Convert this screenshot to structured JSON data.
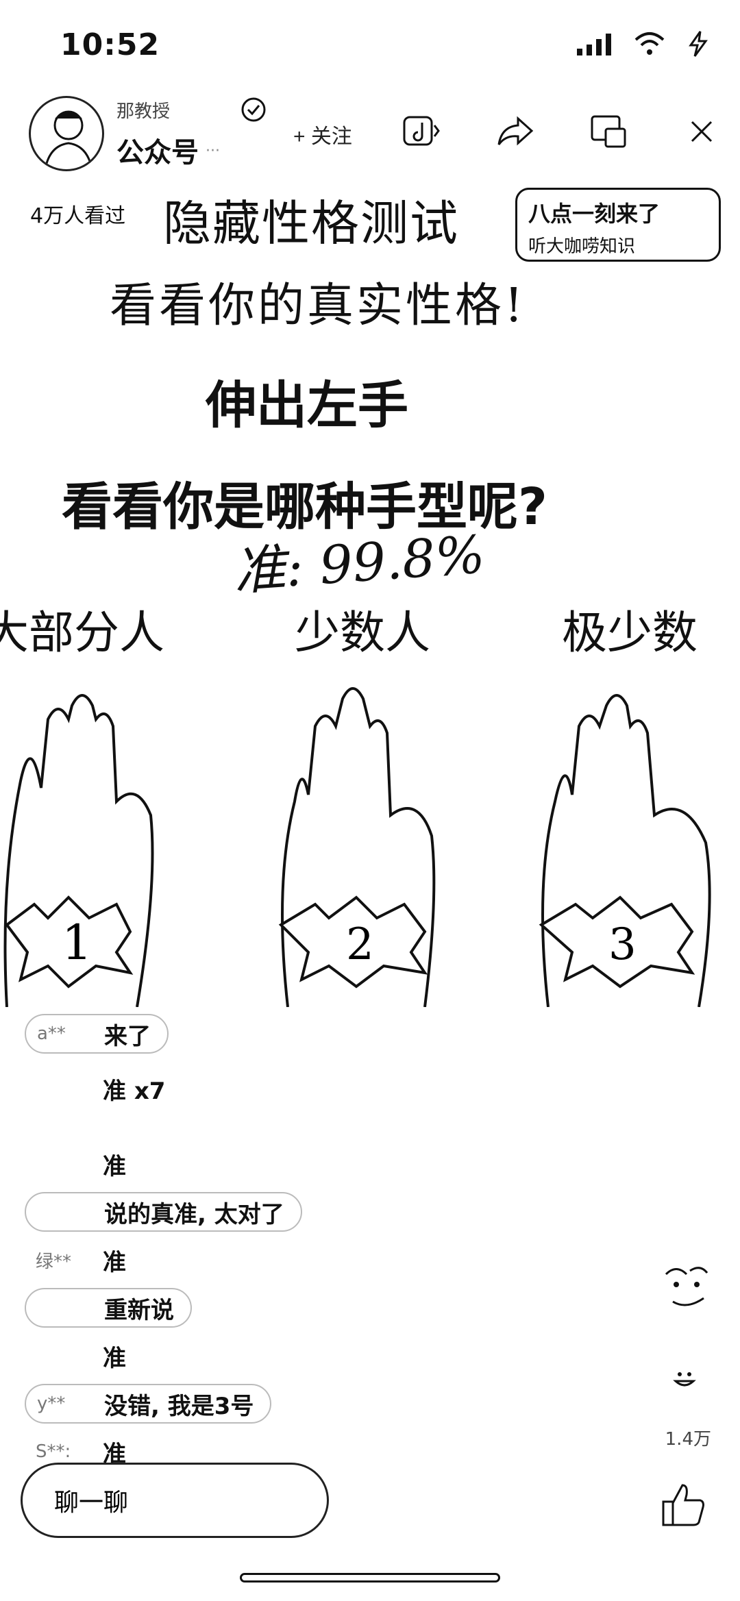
{
  "status_bar": {
    "time": "10:52"
  },
  "header": {
    "account_name": "那教授",
    "account_type": "公众号",
    "account_dots": "···",
    "follow_label": "+ 关注"
  },
  "video": {
    "views": "4万人看过",
    "title": "隐藏性格测试",
    "promo_line1": "八点一刻来了",
    "promo_line2": "听大咖唠知识",
    "subtitle": "看看你的真实性格!",
    "instruction1": "伸出左手",
    "instruction2": "看看你是哪种手型呢?",
    "accuracy": "准: 99.8%",
    "columns": [
      {
        "label": "大部分人",
        "number": "1"
      },
      {
        "label": "少数人",
        "number": "2"
      },
      {
        "label": "极少数",
        "number": "3"
      }
    ]
  },
  "comments": [
    {
      "user": "a**",
      "text": "来了",
      "pill": true
    },
    {
      "user": "",
      "text": "准 x7",
      "pill": false
    },
    {
      "user": "",
      "text": "准",
      "pill": false
    },
    {
      "user": "",
      "text": "说的真准, 太对了",
      "pill": true
    },
    {
      "user": "绿**",
      "text": "准",
      "pill": false
    },
    {
      "user": "",
      "text": "重新说",
      "pill": true
    },
    {
      "user": "",
      "text": "准",
      "pill": false
    },
    {
      "user": "y**",
      "text": "没错, 我是3号",
      "pill": true
    },
    {
      "user": "S**:",
      "text": "准",
      "pill": false
    }
  ],
  "side": {
    "like_count": "1.4万"
  },
  "chat": {
    "label": "聊一聊"
  }
}
